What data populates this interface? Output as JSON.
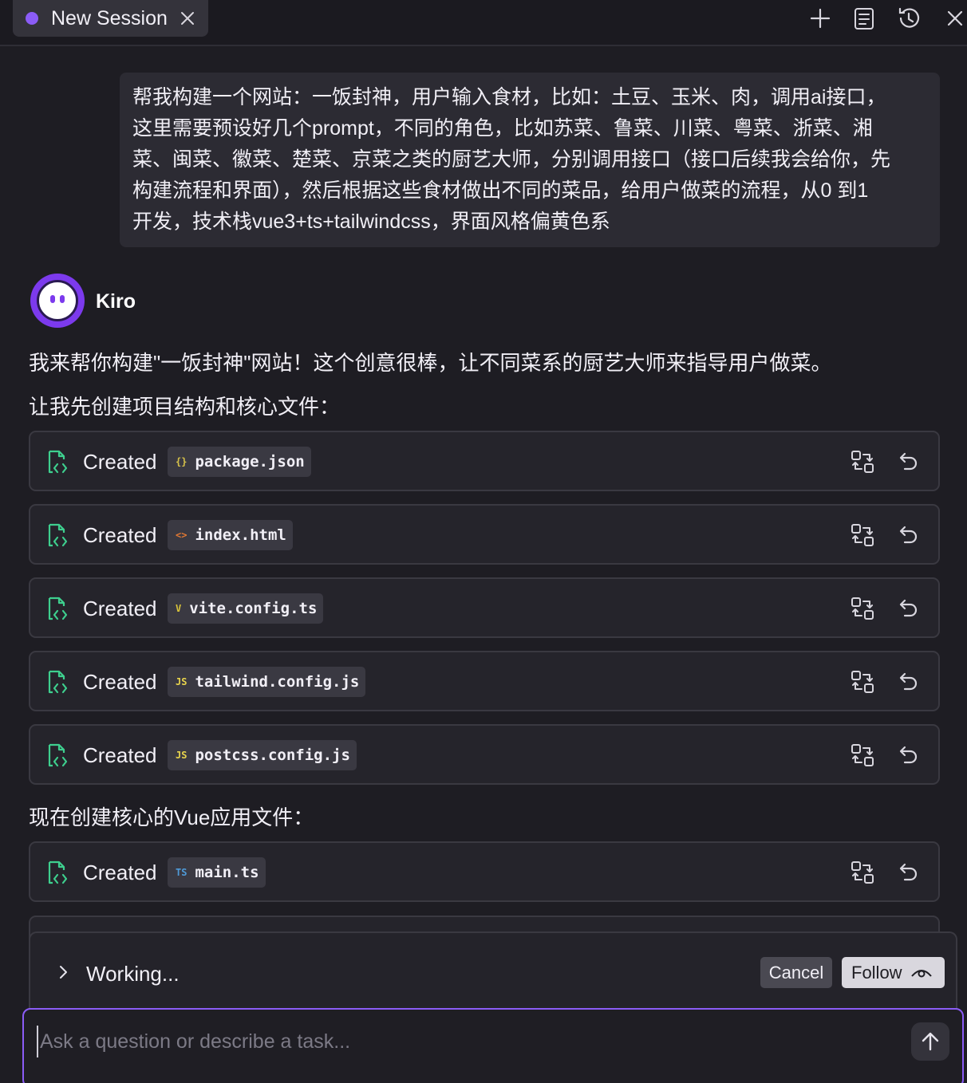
{
  "tab": {
    "title": "New Session"
  },
  "colors": {
    "accent": "#8b5cf6",
    "created_icon": "#3ecf8e",
    "json_icon": "#d7c24a",
    "html_icon": "#e37933",
    "vite_icon": "#d9c43a",
    "js_icon": "#e8d44d",
    "ts_icon": "#4f9bd9"
  },
  "user_message": "帮我构建一个网站：一饭封神，用户输入食材，比如：土豆、玉米、肉，调用ai接口，\n这里需要预设好几个prompt，不同的角色，比如苏菜、鲁菜、川菜、粤菜、浙菜、湘\n菜、闽菜、徽菜、楚菜、京菜之类的厨艺大师，分别调用接口（接口后续我会给你，先\n构建流程和界面），然后根据这些食材做出不同的菜品，给用户做菜的流程，从0 到1\n开发，技术栈vue3+ts+tailwindcss，界面风格偏黄色系",
  "agent": {
    "name": "Kiro"
  },
  "messages": {
    "intro": "我来帮你构建\"一饭封神\"网站！这个创意很棒，让不同菜系的厨艺大师来指导用户做菜。",
    "step1": "让我先创建项目结构和核心文件：",
    "step2": "现在创建核心的Vue应用文件："
  },
  "files": [
    {
      "action": "Created",
      "icon_text": "{}",
      "icon_name": "json-file-icon",
      "name": "package.json"
    },
    {
      "action": "Created",
      "icon_text": "<>",
      "icon_name": "html-file-icon",
      "name": "index.html"
    },
    {
      "action": "Created",
      "icon_text": "V",
      "icon_name": "vite-file-icon",
      "name": "vite.config.ts"
    },
    {
      "action": "Created",
      "icon_text": "JS",
      "icon_name": "js-file-icon",
      "name": "tailwind.config.js"
    },
    {
      "action": "Created",
      "icon_text": "JS",
      "icon_name": "js-file-icon",
      "name": "postcss.config.js"
    },
    {
      "action": "Created",
      "icon_text": "TS",
      "icon_name": "ts-file-icon",
      "name": "main.ts"
    }
  ],
  "status": {
    "working": "Working...",
    "cancel": "Cancel",
    "follow": "Follow"
  },
  "input": {
    "placeholder": "Ask a question or describe a task..."
  }
}
